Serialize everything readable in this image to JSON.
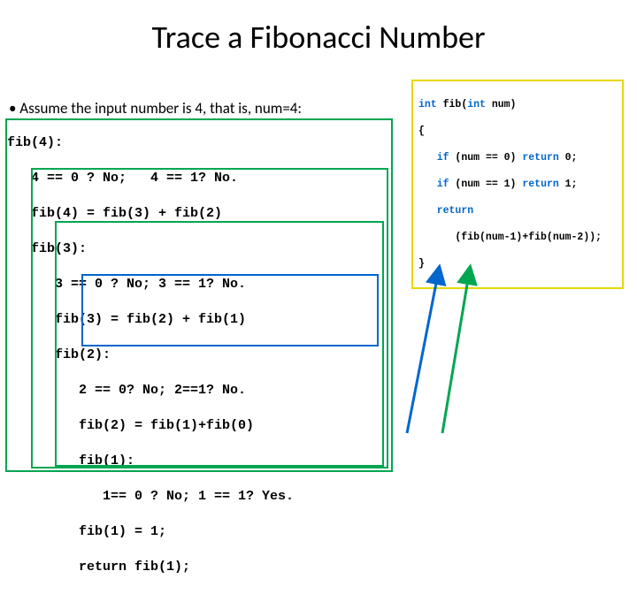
{
  "title": "Trace a Fibonacci Number",
  "bullet": "•   Assume the input number is 4, that is, num=4:",
  "trace": {
    "l0": "fib(4):",
    "l1": "   4 == 0 ? No;   4 == 1? No.",
    "l2": "   fib(4) = fib(3) + fib(2)",
    "l3": "   fib(3):",
    "l4": "      3 == 0 ? No; 3 == 1? No.",
    "l5": "      fib(3) = fib(2) + fib(1)",
    "l6": "      fib(2):",
    "l7": "         2 == 0? No; 2==1? No.",
    "l8": "         fib(2) = fib(1)+fib(0)",
    "l9": "         fib(1):",
    "l10": "            1== 0 ? No; 1 == 1? Yes.",
    "l11": "         fib(1) = 1;",
    "l12_a": "         ",
    "l12_b": "return",
    "l12_c": " fib(1);"
  },
  "code": {
    "l0_a": "int",
    "l0_b": " fib(",
    "l0_c": "int",
    "l0_d": " num)",
    "l1": "{",
    "l2_a": "   ",
    "l2_b": "if",
    "l2_c": " (num == 0) ",
    "l2_d": "return",
    "l2_e": " 0;",
    "l3_a": "   ",
    "l3_b": "if",
    "l3_c": " (num == 1) ",
    "l3_d": "return",
    "l3_e": " 1;",
    "l4_a": "   ",
    "l4_b": "return",
    "l5": "      (fib(num-1)+fib(num-2));",
    "l6": "}"
  },
  "colors": {
    "green": "#00a651",
    "blue": "#0066cc",
    "yellow": "#e6d800"
  }
}
